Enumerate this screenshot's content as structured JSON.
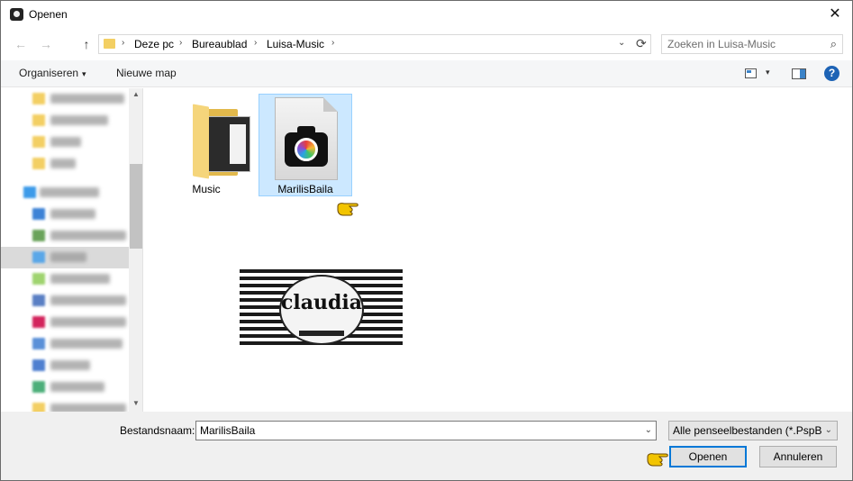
{
  "window": {
    "title": "Openen",
    "close_glyph": "✕"
  },
  "nav": {
    "back_glyph": "←",
    "forward_glyph": "→",
    "up_glyph": "↑",
    "path": [
      "Deze pc",
      "Bureaublad",
      "Luisa-Music"
    ],
    "separator": "›",
    "dropdown_glyph": "⌄",
    "refresh_glyph": "⟳"
  },
  "search": {
    "placeholder": "Zoeken in Luisa-Music",
    "icon_glyph": "⌕"
  },
  "toolbar": {
    "organize_label": "Organiseren",
    "organize_caret": "▾",
    "new_folder_label": "Nieuwe map",
    "view_caret": "▾",
    "help_glyph": "?"
  },
  "sidebar": {
    "scroll_up_glyph": "▲",
    "scroll_down_glyph": "▼",
    "selected_index": 7,
    "items_blurred": true
  },
  "files": {
    "items": [
      {
        "label": "Music",
        "type": "folder",
        "selected": false
      },
      {
        "label": "MarilisBaila",
        "type": "psp-image",
        "selected": true
      }
    ]
  },
  "watermark": {
    "text": "claudia"
  },
  "bottom": {
    "filename_label": "Bestandsnaam:",
    "filename_value": "MarilisBaila",
    "filename_drop": "⌄",
    "filetype_value": "Alle penseelbestanden (*.PspBr",
    "filetype_drop": "⌄",
    "open_label": "Openen",
    "cancel_label": "Annuleren"
  },
  "colors": {
    "accent": "#0078d7",
    "selection_bg": "#cce8ff",
    "selection_border": "#99d1ff",
    "folder_yellow": "#f5d57b",
    "pointer_hand": "#f2c400"
  }
}
